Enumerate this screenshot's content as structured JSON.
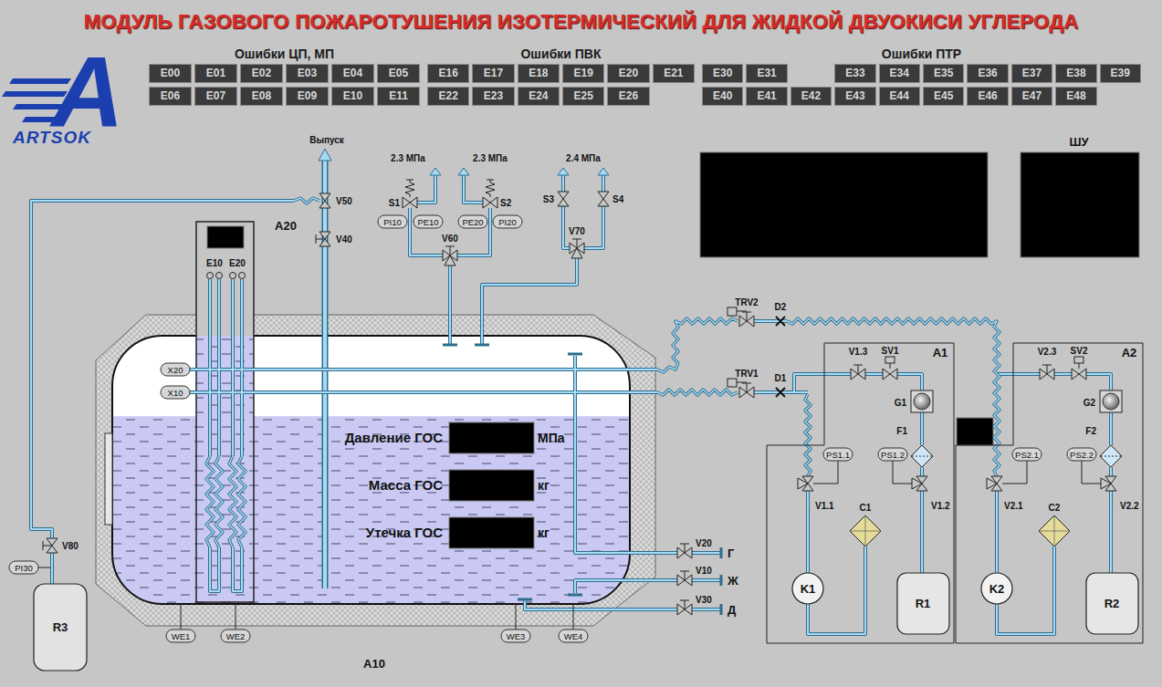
{
  "title": "МОДУЛЬ ГАЗОВОГО ПОЖАРОТУШЕНИЯ ИЗОТЕРМИЧЕСКИЙ ДЛЯ ЖИДКОЙ ДВУОКИСИ УГЛЕРОДА",
  "logo": {
    "letter": "A",
    "name": "ARTSOK"
  },
  "error_groups": [
    {
      "label": "Ошибки ЦП, МП",
      "rows": [
        [
          [
            "E00",
            "E01",
            "E02",
            "E03",
            "E04",
            "E05"
          ]
        ],
        [
          [
            "E06",
            "E07",
            "E08",
            "E09",
            "E10",
            "E11"
          ]
        ]
      ],
      "active_codes": []
    },
    {
      "label": "Ошибки ПВК",
      "rows": [
        [
          [
            "E16",
            "E17",
            "E18",
            "E19",
            "E20",
            "E21"
          ]
        ],
        [
          [
            "E22",
            "E23",
            "E24",
            "E25",
            "E26"
          ]
        ]
      ],
      "active_codes": []
    },
    {
      "label": "Ошибки ПТР",
      "rows": [
        [
          [
            "E30",
            "E31"
          ],
          [
            "E33",
            "E34",
            "E35",
            "E36",
            "E37",
            "E38",
            "E39"
          ]
        ],
        [
          [
            "E40",
            "E41",
            "E42",
            "E43",
            "E44",
            "E45",
            "E46",
            "E47",
            "E48"
          ]
        ]
      ],
      "active_codes": []
    }
  ],
  "panels": {
    "main": {
      "value": ""
    },
    "control": {
      "label": "ШУ",
      "value": ""
    },
    "aux": {
      "value": ""
    },
    "level_gauge": {
      "value": ""
    }
  },
  "readouts": [
    {
      "label": "Давление ГОС",
      "value": "",
      "unit": "МПа"
    },
    {
      "label": "Масса ГОС",
      "value": "",
      "unit": "кг"
    },
    {
      "label": "Утечка ГОС",
      "value": "",
      "unit": "кг"
    }
  ],
  "tank": {
    "label": "A10",
    "level": 0.7
  },
  "labels": {
    "vent": "Выпуск",
    "gauge": "A20",
    "v50": "V50",
    "v40": "V40",
    "e10": "E10",
    "e20": "E20",
    "s1_set": "2.3 МПа",
    "s2_set": "2.3 МПа",
    "s34_set": "2.4 МПа",
    "s1": "S1",
    "s2": "S2",
    "s3": "S3",
    "s4": "S4",
    "pi10": "PI10",
    "pe10": "PE10",
    "pe20": "PE20",
    "pi20": "PI20",
    "v60": "V60",
    "v70": "V70",
    "trv2": "TRV2",
    "d2": "D2",
    "trv1": "TRV1",
    "d1": "D1",
    "x20": "X20",
    "x10": "X10",
    "v20": "V20",
    "v10": "V10",
    "v30": "V30",
    "gas": "Г",
    "liquid": "Ж",
    "drain": "Д",
    "v80": "V80",
    "pi30": "PI30",
    "r3": "R3",
    "we1": "WE1",
    "we2": "WE2",
    "we3": "WE3",
    "we4": "WE4"
  },
  "units": [
    {
      "label": "A1",
      "v3": "V1.3",
      "sv": "SV1",
      "g": "G1",
      "f": "F1",
      "ps1": "PS1.1",
      "ps2": "PS1.2",
      "v1": "V1.1",
      "v2": "V1.2",
      "c": "C1",
      "k": "K1",
      "r": "R1"
    },
    {
      "label": "A2",
      "v3": "V2.3",
      "sv": "SV2",
      "g": "G2",
      "f": "F2",
      "ps1": "PS2.1",
      "ps2": "PS2.2",
      "v1": "V2.1",
      "v2": "V2.2",
      "c": "C2",
      "k": "K2",
      "r": "R2"
    }
  ]
}
